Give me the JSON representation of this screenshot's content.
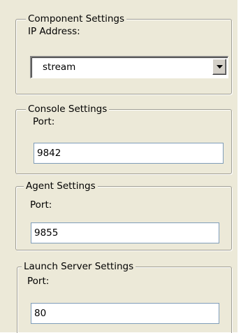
{
  "component_settings": {
    "title": "Component Settings",
    "ip_label": "IP Address:",
    "ip_value": "stream",
    "dropdown_icon": "chevron-down-icon"
  },
  "console_settings": {
    "title": "Console Settings",
    "port_label": "Port:",
    "port_value": "9842"
  },
  "agent_settings": {
    "title": "Agent Settings",
    "port_label": "Port:",
    "port_value": "9855"
  },
  "launch_server_settings": {
    "title": "Launch Server Settings",
    "port_label": "Port:",
    "port_value": "80"
  }
}
